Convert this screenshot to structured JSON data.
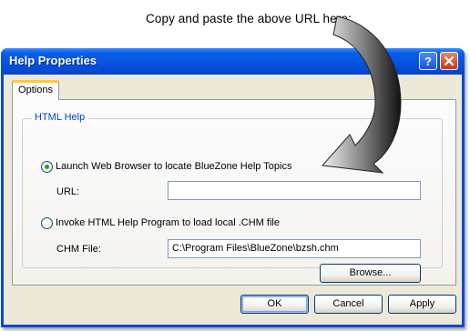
{
  "callout": "Copy and paste the above URL here:",
  "window": {
    "title": "Help Properties",
    "help_button": "?",
    "close_button": "×"
  },
  "tabs": [
    {
      "label": "Options"
    }
  ],
  "group": {
    "label": "HTML Help",
    "radio_web": {
      "label": "Launch Web Browser to locate BlueZone Help Topics",
      "selected": true
    },
    "url_label": "URL:",
    "url_value": "",
    "radio_chm": {
      "label": "Invoke HTML Help Program to load local .CHM file",
      "selected": false
    },
    "chm_label": "CHM File:",
    "chm_value": "C:\\Program Files\\BlueZone\\bzsh.chm",
    "browse_label": "Browse..."
  },
  "footer": {
    "ok_label": "OK",
    "cancel_label": "Cancel",
    "apply_label": "Apply"
  },
  "colors": {
    "titlebar": "#0553df",
    "group_label": "#0046d5",
    "dialog_bg": "#ece9d8",
    "radio_dot": "#21a121"
  }
}
